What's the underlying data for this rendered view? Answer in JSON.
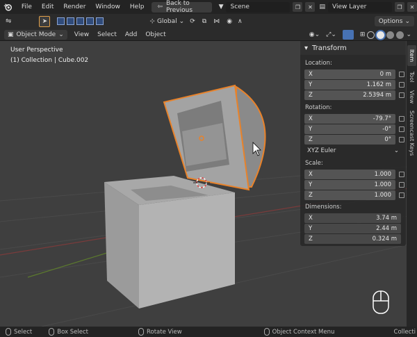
{
  "menu": {
    "items": [
      "File",
      "Edit",
      "Render",
      "Window",
      "Help"
    ],
    "back_label": "Back to Previous",
    "scene": "Scene",
    "view_layer": "View Layer"
  },
  "toolbar": {
    "orientation": "Global",
    "options_label": "Options"
  },
  "header": {
    "mode": "Object Mode",
    "items": [
      "View",
      "Select",
      "Add",
      "Object"
    ]
  },
  "viewport": {
    "perspective": "User Perspective",
    "collection": "(1) Collection | Cube.002"
  },
  "npanel": {
    "title": "Transform",
    "location_label": "Location:",
    "location": [
      {
        "axis": "X",
        "value": "0 m"
      },
      {
        "axis": "Y",
        "value": "1.162 m"
      },
      {
        "axis": "Z",
        "value": "2.5394 m"
      }
    ],
    "rotation_label": "Rotation:",
    "rotation": [
      {
        "axis": "X",
        "value": "-79.7°"
      },
      {
        "axis": "Y",
        "value": "-0°"
      },
      {
        "axis": "Z",
        "value": "0°"
      }
    ],
    "euler": "XYZ Euler",
    "scale_label": "Scale:",
    "scale": [
      {
        "axis": "X",
        "value": "1.000"
      },
      {
        "axis": "Y",
        "value": "1.000"
      },
      {
        "axis": "Z",
        "value": "1.000"
      }
    ],
    "dimensions_label": "Dimensions:",
    "dimensions": [
      {
        "axis": "X",
        "value": "3.74 m"
      },
      {
        "axis": "Y",
        "value": "2.44 m"
      },
      {
        "axis": "Z",
        "value": "0.324 m"
      }
    ]
  },
  "tabs": [
    "Item",
    "Tool",
    "View",
    "Screencast Keys"
  ],
  "status": {
    "select": "Select",
    "box_select": "Box Select",
    "rotate": "Rotate View",
    "context": "Object Context Menu",
    "right": "Collecti"
  },
  "colors": {
    "selection": "#e8822a",
    "accent": "#4772b3",
    "viewport_bg": "#3f3f3f"
  }
}
